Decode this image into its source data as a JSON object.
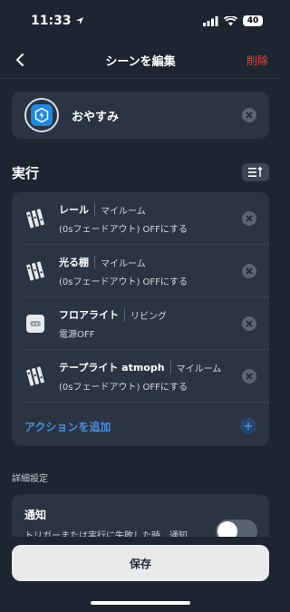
{
  "status": {
    "time": "11:33",
    "battery": "40"
  },
  "nav": {
    "title": "シーンを編集",
    "delete_label": "削除"
  },
  "scene": {
    "name": "おやすみ"
  },
  "execution": {
    "title": "実行",
    "actions": [
      {
        "device": "レール",
        "room": "マイルーム",
        "detail": "(0sフェードアウト) OFFにする",
        "icon": "light-strip-icon"
      },
      {
        "device": "光る棚",
        "room": "マイルーム",
        "detail": "(0sフェードアウト) OFFにする",
        "icon": "light-strip-icon"
      },
      {
        "device": "フロアライト",
        "room": "リビング",
        "detail": "電源OFF",
        "icon": "smart-plug-icon"
      },
      {
        "device": "テープライト atmoph",
        "room": "マイルーム",
        "detail": "(0sフェードアウト) OFFにする",
        "icon": "light-strip-icon"
      }
    ],
    "add_label": "アクションを追加"
  },
  "details": {
    "title": "詳細設定",
    "notify_title": "通知",
    "notify_desc": "トリガーまたは実行に失敗した時、通知",
    "notify_enabled": false
  },
  "save_label": "保存",
  "colors": {
    "background": "#1c2530",
    "card": "#2a3442",
    "accent": "#4a90e2",
    "danger": "#e8463a"
  }
}
